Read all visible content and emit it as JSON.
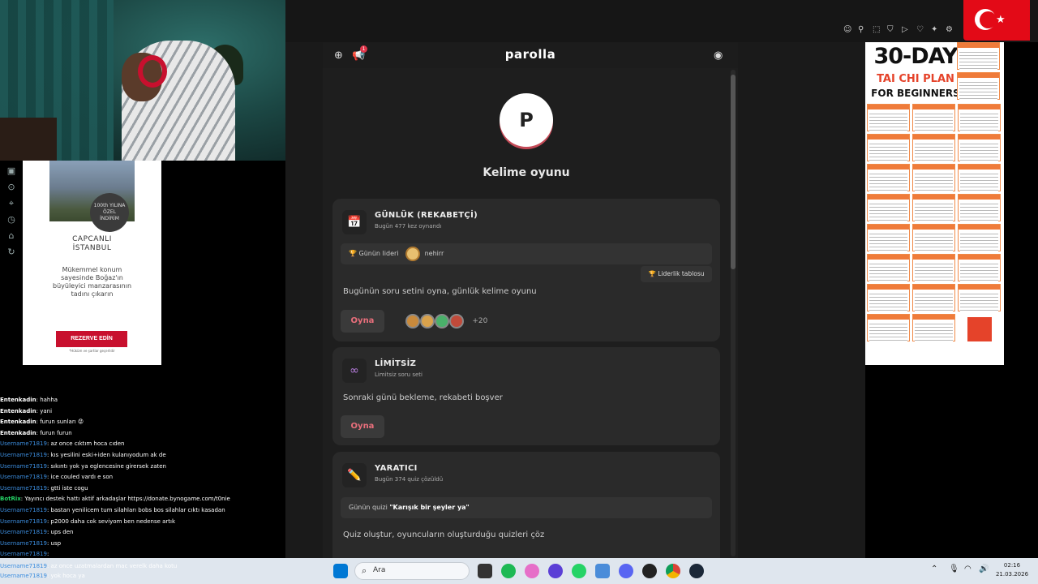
{
  "webcam": {},
  "ad_left": {
    "badge": "100th YILINA ÖZEL İNDİRİM",
    "title_line1": "CAPCANLI",
    "title_line2": "İSTANBUL",
    "text": "Mükemmel konum sayesinde Boğaz'ın büyüleyici manzarasının tadını çıkarın",
    "button": "REZERVE EDİN",
    "footer": "*Hüküm ve şartlar geçerlidir"
  },
  "chat": [
    {
      "user": "Entenkadin",
      "msg": ": hahha",
      "style": "white"
    },
    {
      "user": "Entenkadin",
      "msg": ": yani",
      "style": "white"
    },
    {
      "user": "Entenkadin",
      "msg": ": furun sunları 😡",
      "style": "white"
    },
    {
      "user": "Entenkadin",
      "msg": ": furun furun",
      "style": "white"
    },
    {
      "user": "Username71819",
      "msg": ": az once cıktım hoca cıden",
      "style": "blue"
    },
    {
      "user": "Username71819",
      "msg": ": kıs yesilini eski+iden kulanıyodum ak de",
      "style": "blue"
    },
    {
      "user": "Username71819",
      "msg": ": sıkıntı yok ya eglencesine girersek zaten",
      "style": "blue"
    },
    {
      "user": "Username71819",
      "msg": ": ice couled vardı e son",
      "style": "blue"
    },
    {
      "user": "Username71819",
      "msg": ": gtti iste cogu",
      "style": "blue"
    },
    {
      "user": "BotRix",
      "msg": ": Yayıncı destek hattı aktif arkadaşlar https://donate.bynogame.com/t0nie",
      "style": "green"
    },
    {
      "user": "Username71819",
      "msg": ": bastan yenilicem tum silahları bobs bos silahlar cıktı kasadan",
      "style": "blue"
    },
    {
      "user": "Username71819",
      "msg": ": p2000 daha cok seviyom ben nedense artık",
      "style": "blue"
    },
    {
      "user": "Username71819",
      "msg": ": ups den",
      "style": "blue"
    },
    {
      "user": "Username71819",
      "msg": ": usp",
      "style": "blue"
    },
    {
      "user": "Username71819",
      "msg": ":",
      "style": "blue"
    },
    {
      "user": "Username71819",
      "msg": ": az once uzatmalardan mac verelk daha kotu",
      "style": "blue"
    },
    {
      "user": "Username71819",
      "msg": ": yok hoca ya",
      "style": "blue"
    }
  ],
  "app": {
    "brand": "parolla",
    "notif_count": "1",
    "logo_letter": "P",
    "title": "Kelime oyunu",
    "cards": {
      "daily": {
        "title": "GÜNLÜK (REKABETÇİ)",
        "sub": "Bugün 477 kez oynandı",
        "leader_label": "Günün lideri",
        "leader_name": "nehirr",
        "leaderboard": "🏆 Liderlik tablosu",
        "desc": "Bugünün soru setini oyna, günlük kelime oyunu",
        "play": "Oyna",
        "plus": "+20"
      },
      "unlimited": {
        "title": "LİMİTSİZ",
        "sub": "Limitsiz soru seti",
        "desc": "Sonraki günü bekleme, rekabeti boşver",
        "play": "Oyna"
      },
      "creative": {
        "title": "YARATICI",
        "sub": "Bugün 374 quiz çözüldü",
        "quiz_label": "Günün quizi",
        "quiz_name": "\"Karışık bir şeyler ya\"",
        "desc": "Quiz oluştur, oyuncuların oluşturduğu quizleri çöz"
      }
    }
  },
  "ad_right": {
    "t1": "30-DAY",
    "t2": "TAI CHI PLAN",
    "t3": "FOR BEGINNERS"
  },
  "taskbar": {
    "search": "Ara",
    "time": "02:16",
    "date": "21.03.2026"
  },
  "colors": {
    "accent": "#ea6f7c",
    "card": "#2a2a2a",
    "flag": "#e30a17"
  }
}
